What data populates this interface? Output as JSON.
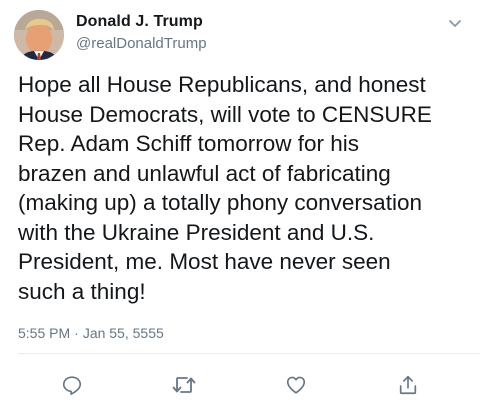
{
  "tweet": {
    "author": {
      "display_name": "Donald J. Trump",
      "handle": "@realDonaldTrump",
      "avatar_icon": "profile-photo"
    },
    "text": "Hope all House Republicans, and honest\nHouse Democrats, will vote to CENSURE\nRep. Adam Schiff tomorrow for his\nbrazen and unlawful act of fabricating\n(making up) a totally phony conversation\nwith the Ukraine President and U.S.\nPresident, me. Most have never seen\nsuch a thing!",
    "time": "5:55 PM",
    "separator": "·",
    "date": "Jan 55, 5555",
    "menu_icon": "chevron-down-icon",
    "actions": [
      {
        "name": "reply",
        "icon": "reply-icon"
      },
      {
        "name": "retweet",
        "icon": "retweet-icon"
      },
      {
        "name": "like",
        "icon": "heart-icon"
      },
      {
        "name": "share",
        "icon": "share-icon"
      }
    ]
  },
  "colors": {
    "text": "#14171a",
    "secondary": "#657786",
    "divider": "#e6ecf0",
    "background": "#ffffff"
  }
}
